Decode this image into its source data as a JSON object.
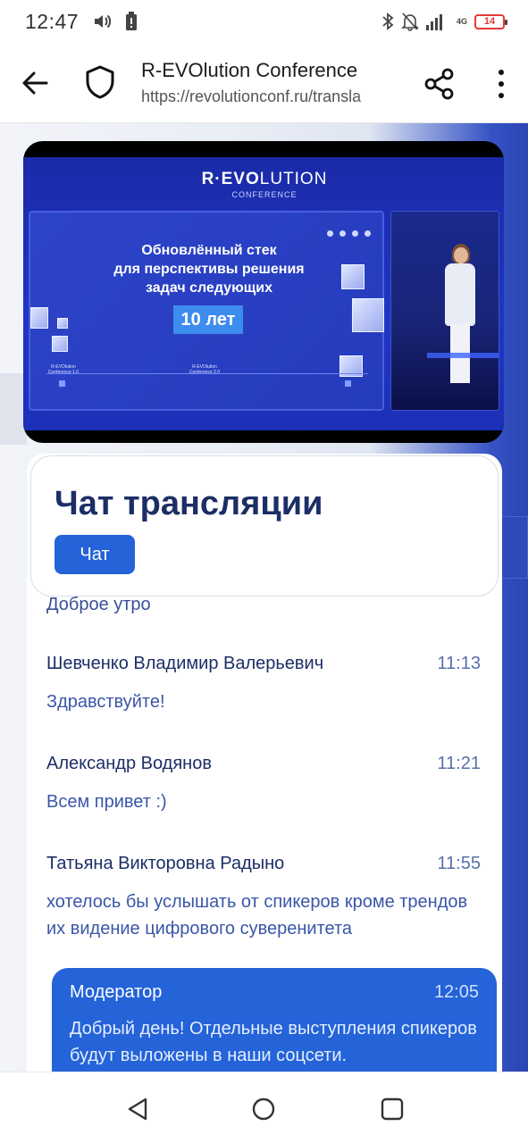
{
  "status_bar": {
    "time": "12:47",
    "network_type": "4G",
    "battery_level": "14",
    "icons": [
      "volume-icon",
      "battery-saver-icon",
      "bluetooth-icon",
      "notifications-off-icon",
      "signal-icon",
      "battery-icon"
    ]
  },
  "browser": {
    "page_title": "R-EVOlution Conference",
    "url": "https://revolutionconf.ru/transla",
    "icons": [
      "back-arrow-icon",
      "shield-icon",
      "share-icon",
      "more-vert-icon"
    ]
  },
  "video": {
    "brand_prefix": "R·EVO",
    "brand_suffix": "LUTION",
    "brand_sub": "CONFERENCE",
    "slide_line1": "Обновлённый стек",
    "slide_line2": "для перспективы решения",
    "slide_line3": "задач следующих",
    "slide_highlight": "10 лет",
    "timeline_label_1": "R-EVOlution Conference 1.0",
    "timeline_label_2": "R-EVOlution Conference 2.0"
  },
  "chat": {
    "title": "Чат трансляции",
    "tab_label": "Чат",
    "partial_message": "Доброе утро",
    "messages": [
      {
        "author": "Шевченко Владимир Валерьевич",
        "time": "11:13",
        "text": "Здравствуйте!"
      },
      {
        "author": "Александр Водянов",
        "time": "11:21",
        "text": "Всем привет :)"
      },
      {
        "author": "Татьяна Викторовна Радыно",
        "time": "11:55",
        "text": "хотелось бы услышать от спикеров кроме трендов их видение цифрового суверенитета"
      }
    ],
    "moderator": {
      "author": "Модератор",
      "time": "12:05",
      "text": "Добрый день! Отдельные выступления спикеров будут выложены в наши соцсети."
    }
  },
  "colors": {
    "accent_blue": "#2463d8",
    "title_navy": "#1c2e66",
    "battery_red": "#e53935"
  },
  "nav_bar": {
    "icons": [
      "nav-back-icon",
      "nav-home-icon",
      "nav-recents-icon"
    ]
  }
}
